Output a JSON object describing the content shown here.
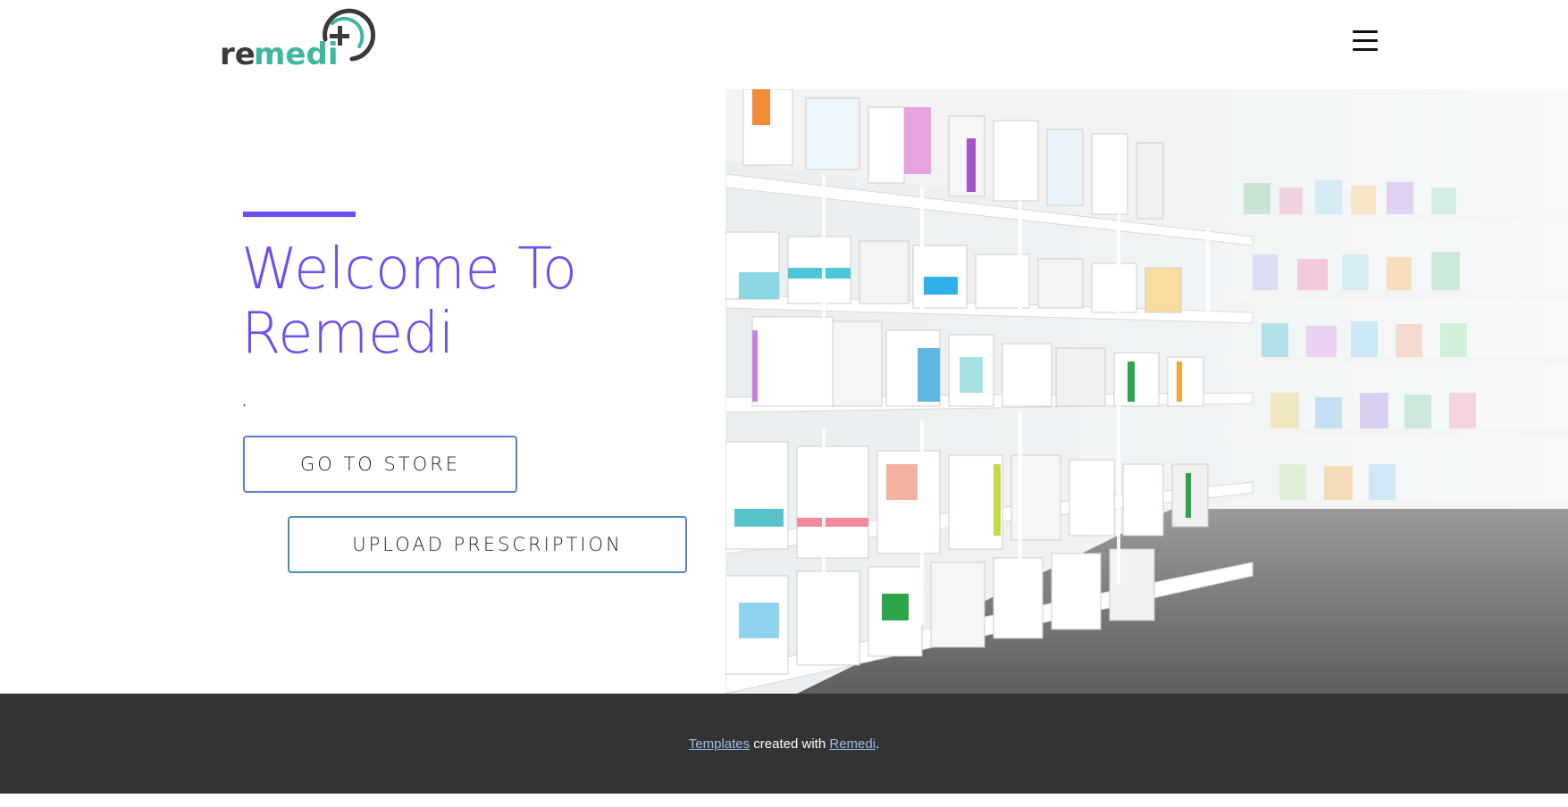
{
  "header": {
    "logo_text_prefix": "re",
    "logo_text_main": "medi",
    "logo_alt": "remedi logo",
    "menu_icon": "hamburger-menu-icon"
  },
  "hero": {
    "title_line1": "Welcome To",
    "title_line2": "Remedi",
    "subtitle": ".",
    "store_button": "GO TO STORE",
    "upload_button": "UPLOAD PRESCRIPTION",
    "image": "pharmacy-shelves-photo"
  },
  "footer": {
    "link1": "Templates",
    "middle_text": " created with ",
    "link2": "Remedi",
    "end_text": "."
  },
  "colors": {
    "accent": "#6c4df2",
    "teal": "#3fb6a0",
    "dark": "#333333",
    "button_border": "#4f8cc9",
    "footer_link": "#9fbbe8"
  }
}
